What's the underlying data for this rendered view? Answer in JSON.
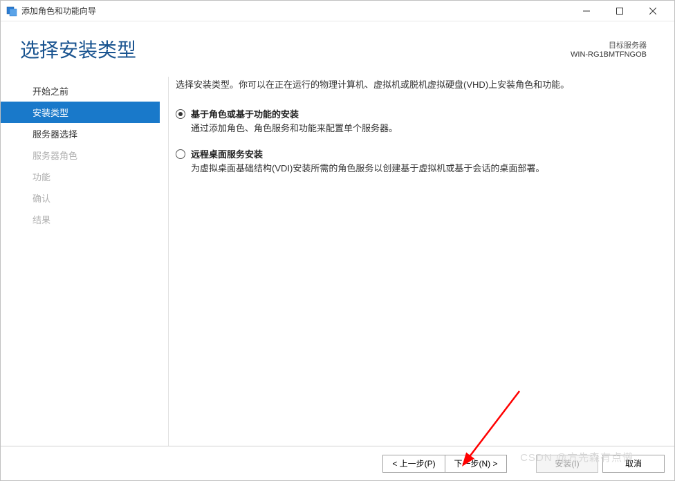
{
  "titlebar": {
    "title": "添加角色和功能向导"
  },
  "header": {
    "page_title": "选择安装类型",
    "server_label": "目标服务器",
    "server_name": "WIN-RG1BMTFNGOB"
  },
  "sidebar": {
    "items": [
      {
        "label": "开始之前",
        "state": "normal"
      },
      {
        "label": "安装类型",
        "state": "active"
      },
      {
        "label": "服务器选择",
        "state": "normal"
      },
      {
        "label": "服务器角色",
        "state": "disabled"
      },
      {
        "label": "功能",
        "state": "disabled"
      },
      {
        "label": "确认",
        "state": "disabled"
      },
      {
        "label": "结果",
        "state": "disabled"
      }
    ]
  },
  "content": {
    "intro": "选择安装类型。你可以在正在运行的物理计算机、虚拟机或脱机虚拟硬盘(VHD)上安装角色和功能。",
    "options": [
      {
        "title": "基于角色或基于功能的安装",
        "desc": "通过添加角色、角色服务和功能来配置单个服务器。",
        "checked": true
      },
      {
        "title": "远程桌面服务安装",
        "desc": "为虚拟桌面基础结构(VDI)安装所需的角色服务以创建基于虚拟机或基于会话的桌面部署。",
        "checked": false
      }
    ]
  },
  "footer": {
    "prev": "< 上一步(P)",
    "next": "下一步(N) >",
    "install": "安装(I)",
    "cancel": "取消"
  },
  "watermark": "CSDN @方先森有点懒"
}
